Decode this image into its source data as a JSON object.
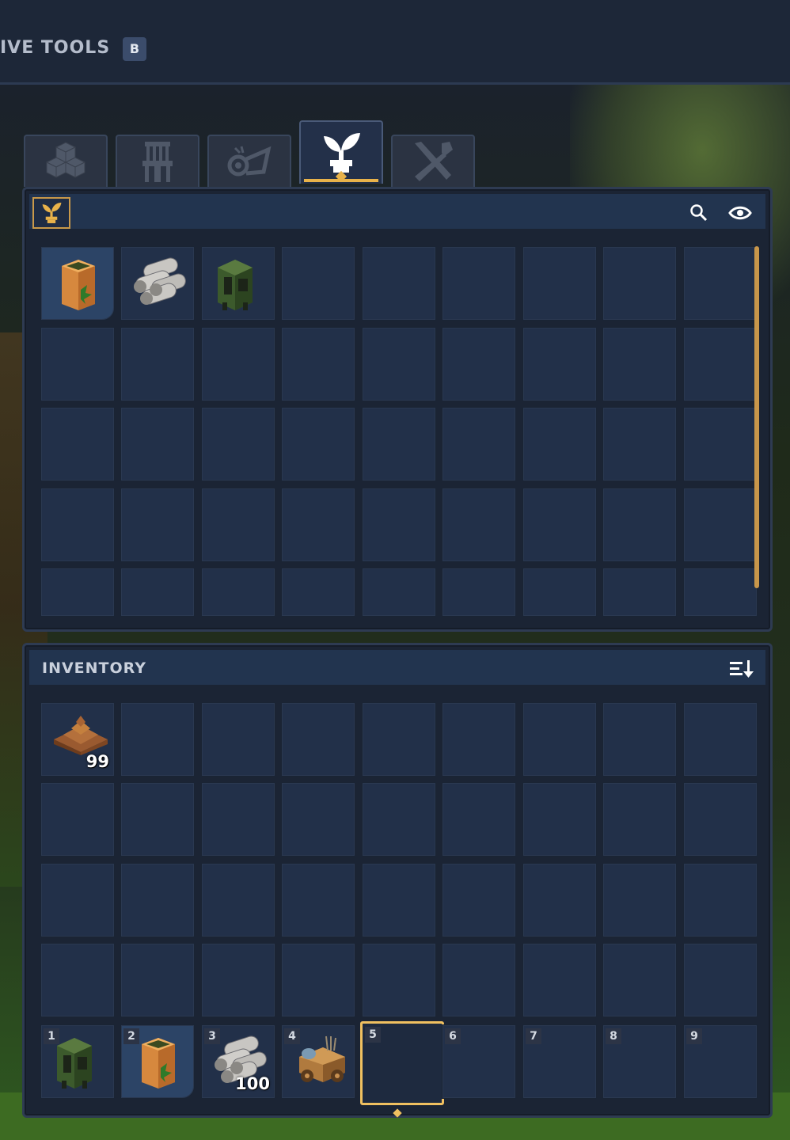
{
  "header": {
    "title": "IVE TOOLS",
    "hotkey": "B"
  },
  "tabs": [
    {
      "icon": "cubes-icon",
      "active": false
    },
    {
      "icon": "chair-icon",
      "active": false
    },
    {
      "icon": "horn-icon",
      "active": false
    },
    {
      "icon": "sprout-icon",
      "active": true
    },
    {
      "icon": "tools-icon",
      "active": false
    }
  ],
  "catalog": {
    "category_icon": "sprout-icon",
    "search_icon": "search-icon",
    "visibility_icon": "eye-icon",
    "items": [
      {
        "icon": "seed-sack-icon",
        "highlight": true
      },
      {
        "icon": "logs-icon"
      },
      {
        "icon": "green-machine-icon"
      }
    ]
  },
  "inventory": {
    "label": "INVENTORY",
    "sort_icon": "sort-icon",
    "items": [
      {
        "icon": "dirt-pile-icon",
        "qty": "99"
      }
    ],
    "hotbar": [
      {
        "num": "1",
        "icon": "green-machine-icon",
        "qty": ""
      },
      {
        "num": "2",
        "icon": "seed-sack-icon",
        "qty": "",
        "highlight": true
      },
      {
        "num": "3",
        "icon": "logs-icon",
        "qty": "100"
      },
      {
        "num": "4",
        "icon": "cart-icon",
        "qty": ""
      },
      {
        "num": "5",
        "icon": "",
        "qty": "",
        "selected": true
      },
      {
        "num": "6"
      },
      {
        "num": "7"
      },
      {
        "num": "8"
      },
      {
        "num": "9"
      }
    ]
  }
}
